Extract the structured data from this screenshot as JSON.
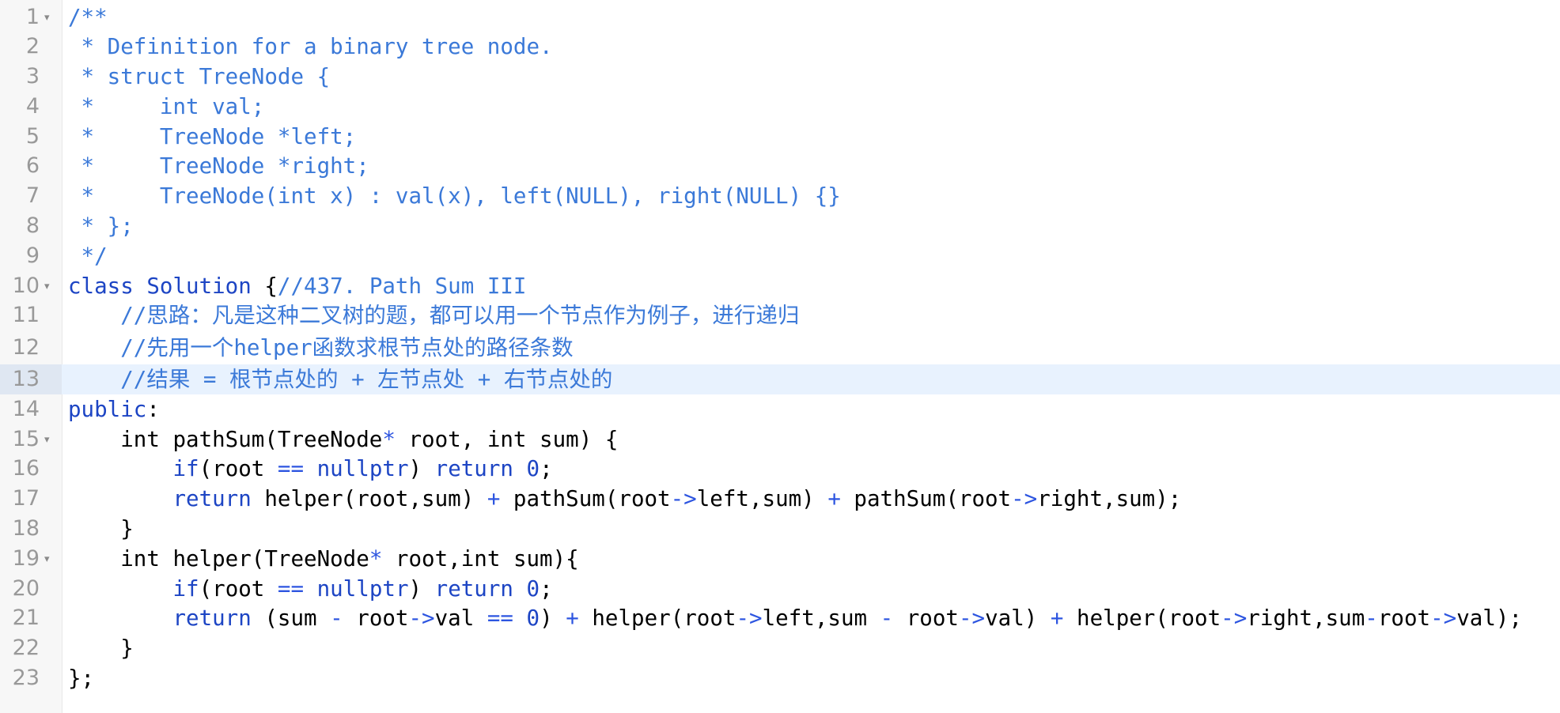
{
  "editor": {
    "active_line": 13,
    "lines": [
      {
        "num": "1",
        "fold": true
      },
      {
        "num": "2"
      },
      {
        "num": "3"
      },
      {
        "num": "4"
      },
      {
        "num": "5"
      },
      {
        "num": "6"
      },
      {
        "num": "7"
      },
      {
        "num": "8"
      },
      {
        "num": "9"
      },
      {
        "num": "10",
        "fold": true
      },
      {
        "num": "11"
      },
      {
        "num": "12"
      },
      {
        "num": "13"
      },
      {
        "num": "14"
      },
      {
        "num": "15",
        "fold": true
      },
      {
        "num": "16"
      },
      {
        "num": "17"
      },
      {
        "num": "18"
      },
      {
        "num": "19",
        "fold": true
      },
      {
        "num": "20"
      },
      {
        "num": "21"
      },
      {
        "num": "22"
      },
      {
        "num": "23"
      }
    ],
    "fold_icon": "▾",
    "code": {
      "l1": "/**",
      "l2": " * Definition for a binary tree node.",
      "l3": " * struct TreeNode {",
      "l4": " *     int val;",
      "l5": " *     TreeNode *left;",
      "l6": " *     TreeNode *right;",
      "l7": " *     TreeNode(int x) : val(x), left(NULL), right(NULL) {}",
      "l8": " * };",
      "l9": " */",
      "l10_kw": "class Solution",
      "l10_brace": " {",
      "l10_comment": "//437. Path Sum III",
      "l11": "    //思路：凡是这种二叉树的题，都可以用一个节点作为例子，进行递归",
      "l12": "    //先用一个helper函数求根节点处的路径条数",
      "l13": "    //结果 = 根节点处的 + 左节点处 + 右节点处的",
      "l14_kw": "public",
      "l14_rest": ":",
      "l15_a": "    int pathSum(TreeNode",
      "l15_b": "*",
      "l15_c": " root, int sum) {",
      "l16_a": "        ",
      "l16_if": "if",
      "l16_b": "(root ",
      "l16_eq": "==",
      "l16_sp": " ",
      "l16_null": "nullptr",
      "l16_c": ") ",
      "l16_ret": "return",
      "l16_d": " ",
      "l16_zero": "0",
      "l16_e": ";",
      "l17_a": "        ",
      "l17_ret": "return",
      "l17_b": " helper(root,sum) ",
      "l17_plus1": "+",
      "l17_c": " pathSum(root",
      "l17_arrow1": "->",
      "l17_d": "left,sum) ",
      "l17_plus2": "+",
      "l17_e": " pathSum(root",
      "l17_arrow2": "->",
      "l17_f": "right,sum);",
      "l18": "    }",
      "l19_a": "    int helper(TreeNode",
      "l19_b": "*",
      "l19_c": " root,int sum){",
      "l20_a": "        ",
      "l20_if": "if",
      "l20_b": "(root ",
      "l20_eq": "==",
      "l20_sp": " ",
      "l20_null": "nullptr",
      "l20_c": ") ",
      "l20_ret": "return",
      "l20_d": " ",
      "l20_zero": "0",
      "l20_e": ";",
      "l21_a": "        ",
      "l21_ret": "return",
      "l21_b": " (sum ",
      "l21_minus1": "-",
      "l21_c": " root",
      "l21_arrow1": "->",
      "l21_d": "val ",
      "l21_eq": "==",
      "l21_sp": " ",
      "l21_zero": "0",
      "l21_e": ") ",
      "l21_plus1": "+",
      "l21_f": " helper(root",
      "l21_arrow2": "->",
      "l21_g": "left,sum ",
      "l21_minus2": "-",
      "l21_h": " root",
      "l21_arrow3": "->",
      "l21_i": "val) ",
      "l21_plus2": "+",
      "l21_j": " helper(root",
      "l21_arrow4": "->",
      "l21_k": "right,sum",
      "l21_minus3": "-",
      "l21_l": "root",
      "l21_arrow5": "->",
      "l21_m": "val);",
      "l22": "    }",
      "l23": "};"
    }
  }
}
